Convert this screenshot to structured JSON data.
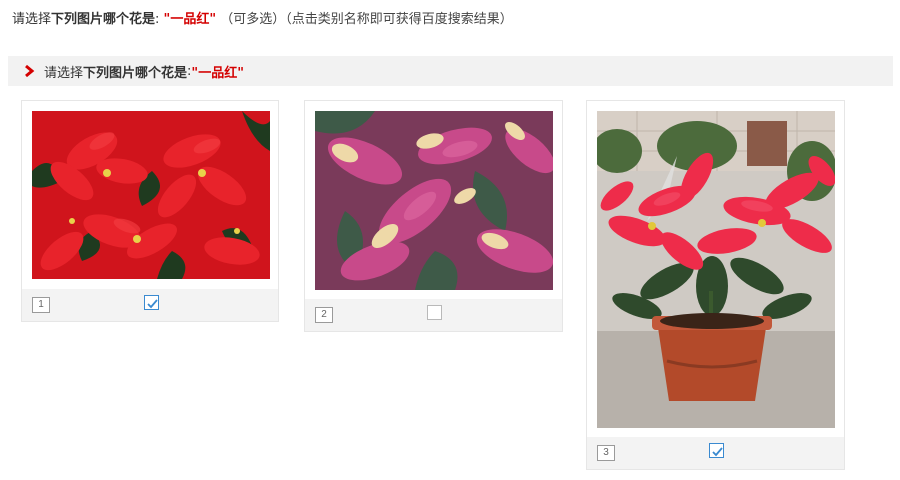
{
  "instruction": {
    "prefix": "请选择",
    "bold_text": "下列图片哪个花是",
    "colon": ": ",
    "answer": "\"一品红\"",
    "multi_hint": "（可多选）",
    "search_hint": "（点击类别名称即可获得百度搜索结果）"
  },
  "section": {
    "prefix": "请选择",
    "bold_text": "下列图片哪个花是",
    "colon": ": ",
    "answer": "\"一品红\""
  },
  "options": [
    {
      "number": "1",
      "checked": true,
      "image_desc": "red-poinsettia-leaves-closeup"
    },
    {
      "number": "2",
      "checked": false,
      "image_desc": "pink-cream-variegated-poinsettia"
    },
    {
      "number": "3",
      "checked": true,
      "image_desc": "red-poinsettia-in-clay-pot"
    }
  ],
  "colors": {
    "accent_red": "#d40000",
    "checkbox_blue": "#3a8ad0",
    "bar_gray": "#f2f2f2"
  },
  "icons": {
    "section_marker": "chevron-right-icon",
    "checkmark": "check-icon"
  }
}
